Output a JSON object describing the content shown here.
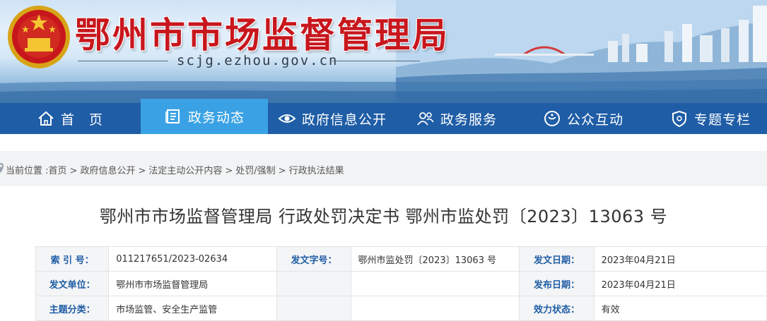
{
  "header": {
    "site_title": "鄂州市市场监督管理局",
    "site_url": "scjg.ezhou.gov.cn",
    "emblem_icon": "national-emblem",
    "title_color": "#c8161d"
  },
  "nav": {
    "background": "#1f5da6",
    "active_background": "#3aa2e4",
    "items": [
      {
        "label": "首　页",
        "icon": "home-icon",
        "active": false
      },
      {
        "label": "政务动态",
        "icon": "document-icon",
        "active": true
      },
      {
        "label": "政府信息公开",
        "icon": "eye-icon",
        "active": false
      },
      {
        "label": "政务服务",
        "icon": "handshake-icon",
        "active": false
      },
      {
        "label": "公众互动",
        "icon": "chat-icon",
        "active": false
      },
      {
        "label": "专题专栏",
        "icon": "shield-icon",
        "active": false
      }
    ]
  },
  "breadcrumb": {
    "prefix": "当前位置 :",
    "items": [
      "首页",
      "政府信息公开",
      "法定主动公开内容",
      "处罚/强制",
      "行政执法结果"
    ],
    "separator": ">"
  },
  "document": {
    "title": "鄂州市市场监督管理局 行政处罚决定书 鄂州市监处罚〔2023〕13063 号"
  },
  "meta": {
    "rows": [
      [
        {
          "key": "索 引 号：",
          "value": "011217651/2023-02634"
        },
        {
          "key": "发文字号：",
          "value": "鄂州市监处罚〔2023〕13063 号"
        },
        {
          "key": "发文日期：",
          "value": "2023年04月21日"
        }
      ],
      [
        {
          "key": "发文单位：",
          "value": "鄂州市市场监督管理局"
        },
        {
          "key": "",
          "value": ""
        },
        {
          "key": "发布日期：",
          "value": "2023年04月21日"
        }
      ],
      [
        {
          "key": "主题分类：",
          "value": "市场监管、安全生产监管"
        },
        {
          "key": "",
          "value": ""
        },
        {
          "key": "效力状态：",
          "value": "有效"
        }
      ]
    ]
  }
}
